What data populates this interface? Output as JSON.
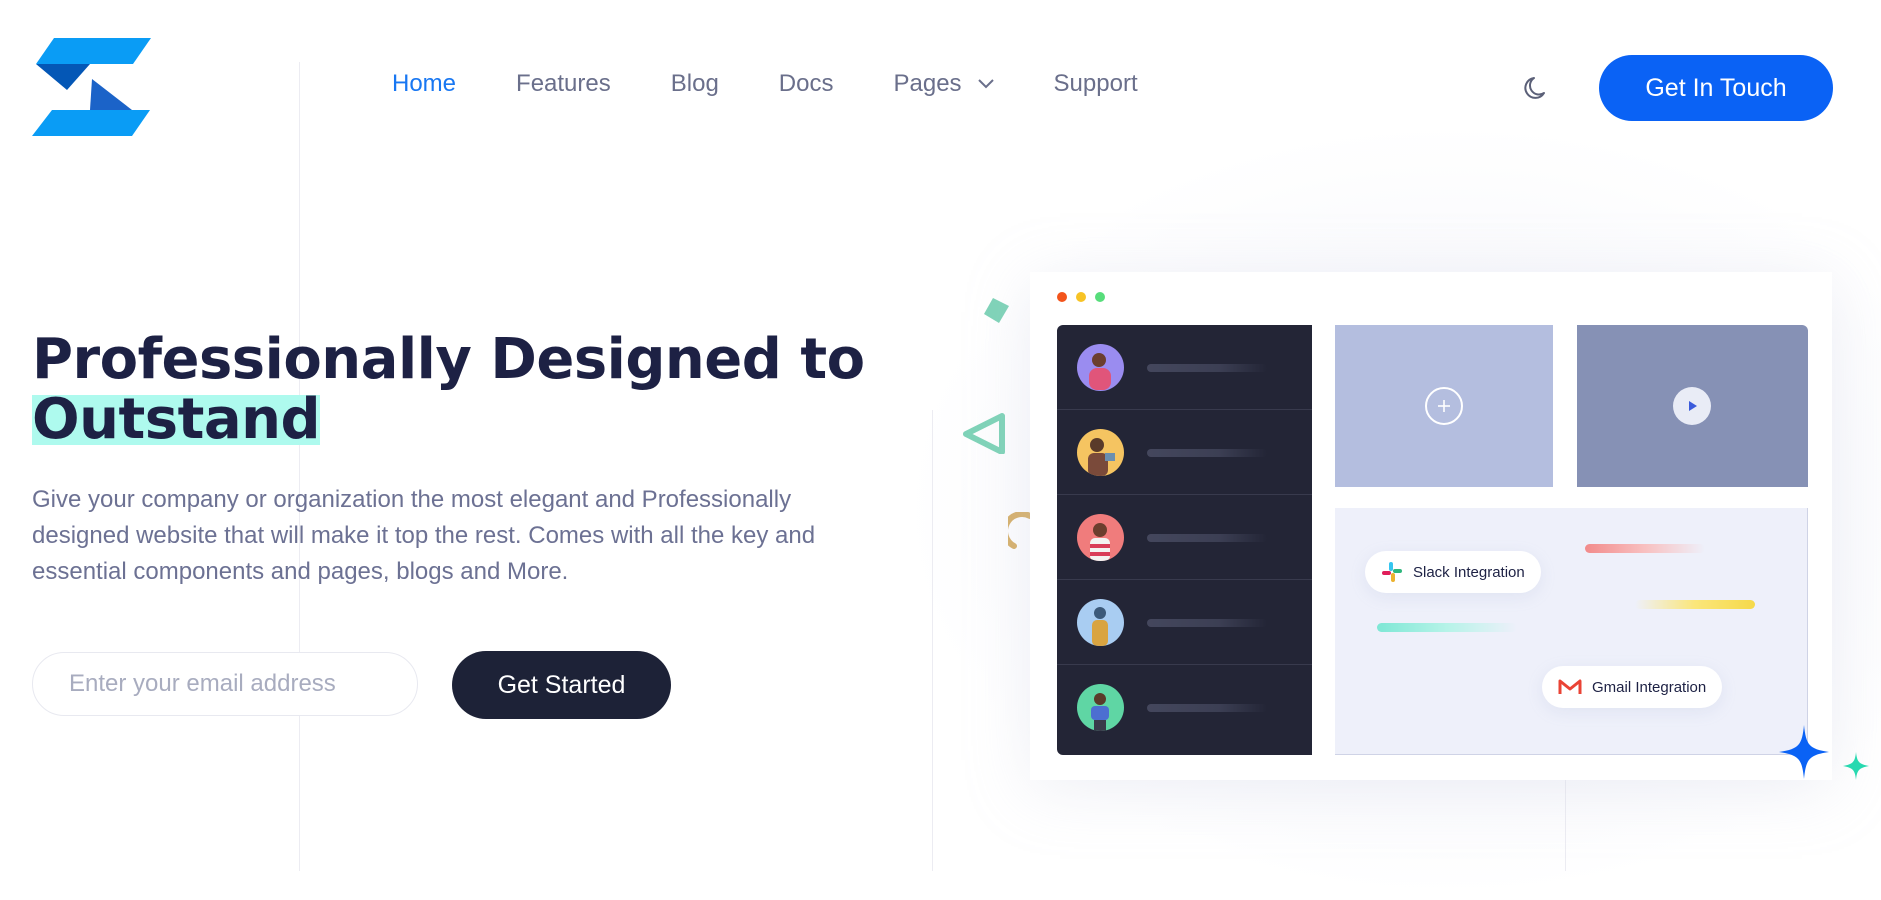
{
  "nav": {
    "items": [
      {
        "label": "Home",
        "active": true
      },
      {
        "label": "Features"
      },
      {
        "label": "Blog"
      },
      {
        "label": "Docs"
      },
      {
        "label": "Pages",
        "dropdown": true
      },
      {
        "label": "Support"
      }
    ],
    "cta_label": "Get In Touch"
  },
  "hero": {
    "title_line1": "Professionally Designed to",
    "title_highlight": "Outstand",
    "description": "Give your company or organization the most elegant and Professionally designed website that will make it top the rest. Comes with all the key and essential components and pages, blogs and More.",
    "email_placeholder": "Enter your email address",
    "button_label": "Get Started"
  },
  "mockup": {
    "integrations": [
      "Slack Integration",
      "Gmail Integration"
    ]
  },
  "colors": {
    "brand_blue": "#0a62f5",
    "nav_active": "#1877f2",
    "dark": "#1d2237",
    "highlight": "#aefaee"
  }
}
